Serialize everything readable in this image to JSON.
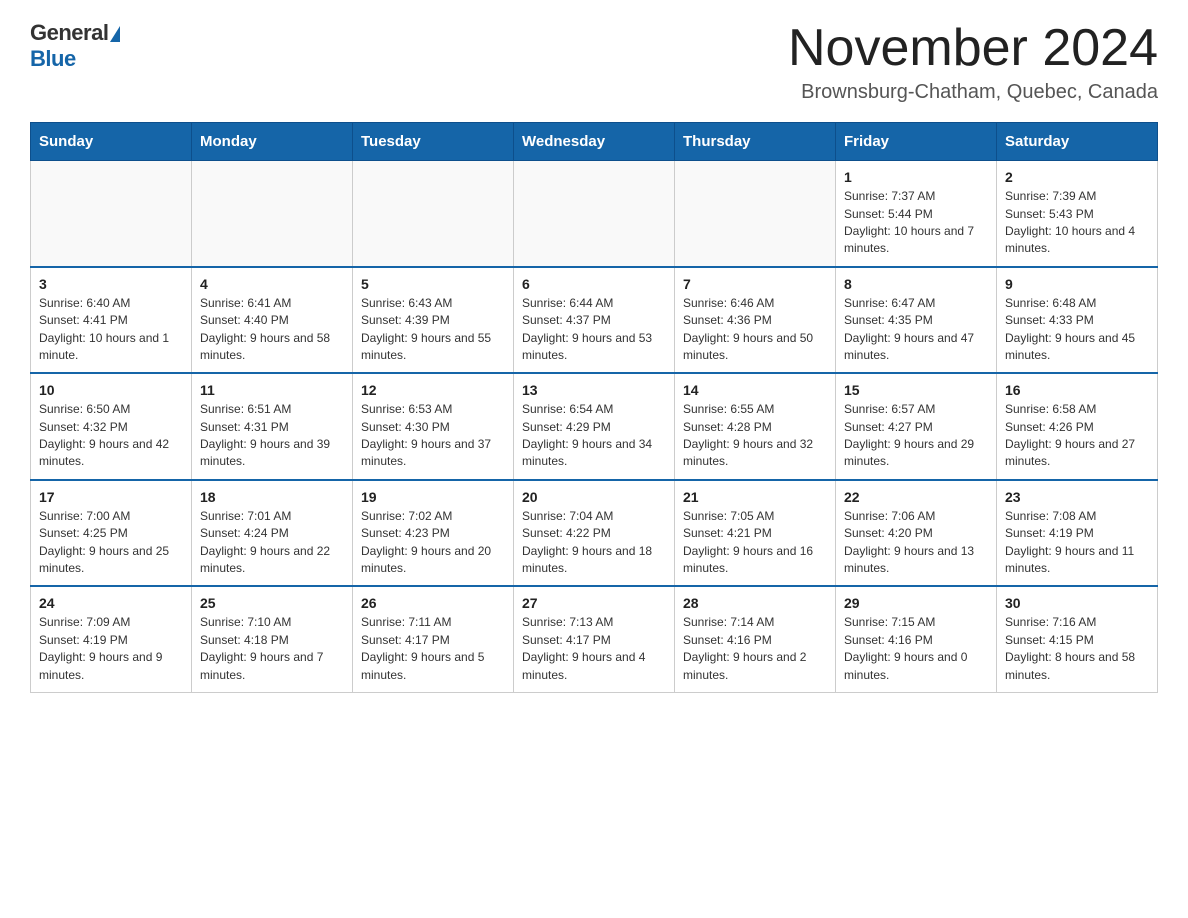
{
  "header": {
    "logo_general": "General",
    "logo_blue": "Blue",
    "title": "November 2024",
    "subtitle": "Brownsburg-Chatham, Quebec, Canada"
  },
  "weekdays": [
    "Sunday",
    "Monday",
    "Tuesday",
    "Wednesday",
    "Thursday",
    "Friday",
    "Saturday"
  ],
  "weeks": [
    [
      {
        "day": "",
        "info": ""
      },
      {
        "day": "",
        "info": ""
      },
      {
        "day": "",
        "info": ""
      },
      {
        "day": "",
        "info": ""
      },
      {
        "day": "",
        "info": ""
      },
      {
        "day": "1",
        "info": "Sunrise: 7:37 AM\nSunset: 5:44 PM\nDaylight: 10 hours and 7 minutes."
      },
      {
        "day": "2",
        "info": "Sunrise: 7:39 AM\nSunset: 5:43 PM\nDaylight: 10 hours and 4 minutes."
      }
    ],
    [
      {
        "day": "3",
        "info": "Sunrise: 6:40 AM\nSunset: 4:41 PM\nDaylight: 10 hours and 1 minute."
      },
      {
        "day": "4",
        "info": "Sunrise: 6:41 AM\nSunset: 4:40 PM\nDaylight: 9 hours and 58 minutes."
      },
      {
        "day": "5",
        "info": "Sunrise: 6:43 AM\nSunset: 4:39 PM\nDaylight: 9 hours and 55 minutes."
      },
      {
        "day": "6",
        "info": "Sunrise: 6:44 AM\nSunset: 4:37 PM\nDaylight: 9 hours and 53 minutes."
      },
      {
        "day": "7",
        "info": "Sunrise: 6:46 AM\nSunset: 4:36 PM\nDaylight: 9 hours and 50 minutes."
      },
      {
        "day": "8",
        "info": "Sunrise: 6:47 AM\nSunset: 4:35 PM\nDaylight: 9 hours and 47 minutes."
      },
      {
        "day": "9",
        "info": "Sunrise: 6:48 AM\nSunset: 4:33 PM\nDaylight: 9 hours and 45 minutes."
      }
    ],
    [
      {
        "day": "10",
        "info": "Sunrise: 6:50 AM\nSunset: 4:32 PM\nDaylight: 9 hours and 42 minutes."
      },
      {
        "day": "11",
        "info": "Sunrise: 6:51 AM\nSunset: 4:31 PM\nDaylight: 9 hours and 39 minutes."
      },
      {
        "day": "12",
        "info": "Sunrise: 6:53 AM\nSunset: 4:30 PM\nDaylight: 9 hours and 37 minutes."
      },
      {
        "day": "13",
        "info": "Sunrise: 6:54 AM\nSunset: 4:29 PM\nDaylight: 9 hours and 34 minutes."
      },
      {
        "day": "14",
        "info": "Sunrise: 6:55 AM\nSunset: 4:28 PM\nDaylight: 9 hours and 32 minutes."
      },
      {
        "day": "15",
        "info": "Sunrise: 6:57 AM\nSunset: 4:27 PM\nDaylight: 9 hours and 29 minutes."
      },
      {
        "day": "16",
        "info": "Sunrise: 6:58 AM\nSunset: 4:26 PM\nDaylight: 9 hours and 27 minutes."
      }
    ],
    [
      {
        "day": "17",
        "info": "Sunrise: 7:00 AM\nSunset: 4:25 PM\nDaylight: 9 hours and 25 minutes."
      },
      {
        "day": "18",
        "info": "Sunrise: 7:01 AM\nSunset: 4:24 PM\nDaylight: 9 hours and 22 minutes."
      },
      {
        "day": "19",
        "info": "Sunrise: 7:02 AM\nSunset: 4:23 PM\nDaylight: 9 hours and 20 minutes."
      },
      {
        "day": "20",
        "info": "Sunrise: 7:04 AM\nSunset: 4:22 PM\nDaylight: 9 hours and 18 minutes."
      },
      {
        "day": "21",
        "info": "Sunrise: 7:05 AM\nSunset: 4:21 PM\nDaylight: 9 hours and 16 minutes."
      },
      {
        "day": "22",
        "info": "Sunrise: 7:06 AM\nSunset: 4:20 PM\nDaylight: 9 hours and 13 minutes."
      },
      {
        "day": "23",
        "info": "Sunrise: 7:08 AM\nSunset: 4:19 PM\nDaylight: 9 hours and 11 minutes."
      }
    ],
    [
      {
        "day": "24",
        "info": "Sunrise: 7:09 AM\nSunset: 4:19 PM\nDaylight: 9 hours and 9 minutes."
      },
      {
        "day": "25",
        "info": "Sunrise: 7:10 AM\nSunset: 4:18 PM\nDaylight: 9 hours and 7 minutes."
      },
      {
        "day": "26",
        "info": "Sunrise: 7:11 AM\nSunset: 4:17 PM\nDaylight: 9 hours and 5 minutes."
      },
      {
        "day": "27",
        "info": "Sunrise: 7:13 AM\nSunset: 4:17 PM\nDaylight: 9 hours and 4 minutes."
      },
      {
        "day": "28",
        "info": "Sunrise: 7:14 AM\nSunset: 4:16 PM\nDaylight: 9 hours and 2 minutes."
      },
      {
        "day": "29",
        "info": "Sunrise: 7:15 AM\nSunset: 4:16 PM\nDaylight: 9 hours and 0 minutes."
      },
      {
        "day": "30",
        "info": "Sunrise: 7:16 AM\nSunset: 4:15 PM\nDaylight: 8 hours and 58 minutes."
      }
    ]
  ]
}
